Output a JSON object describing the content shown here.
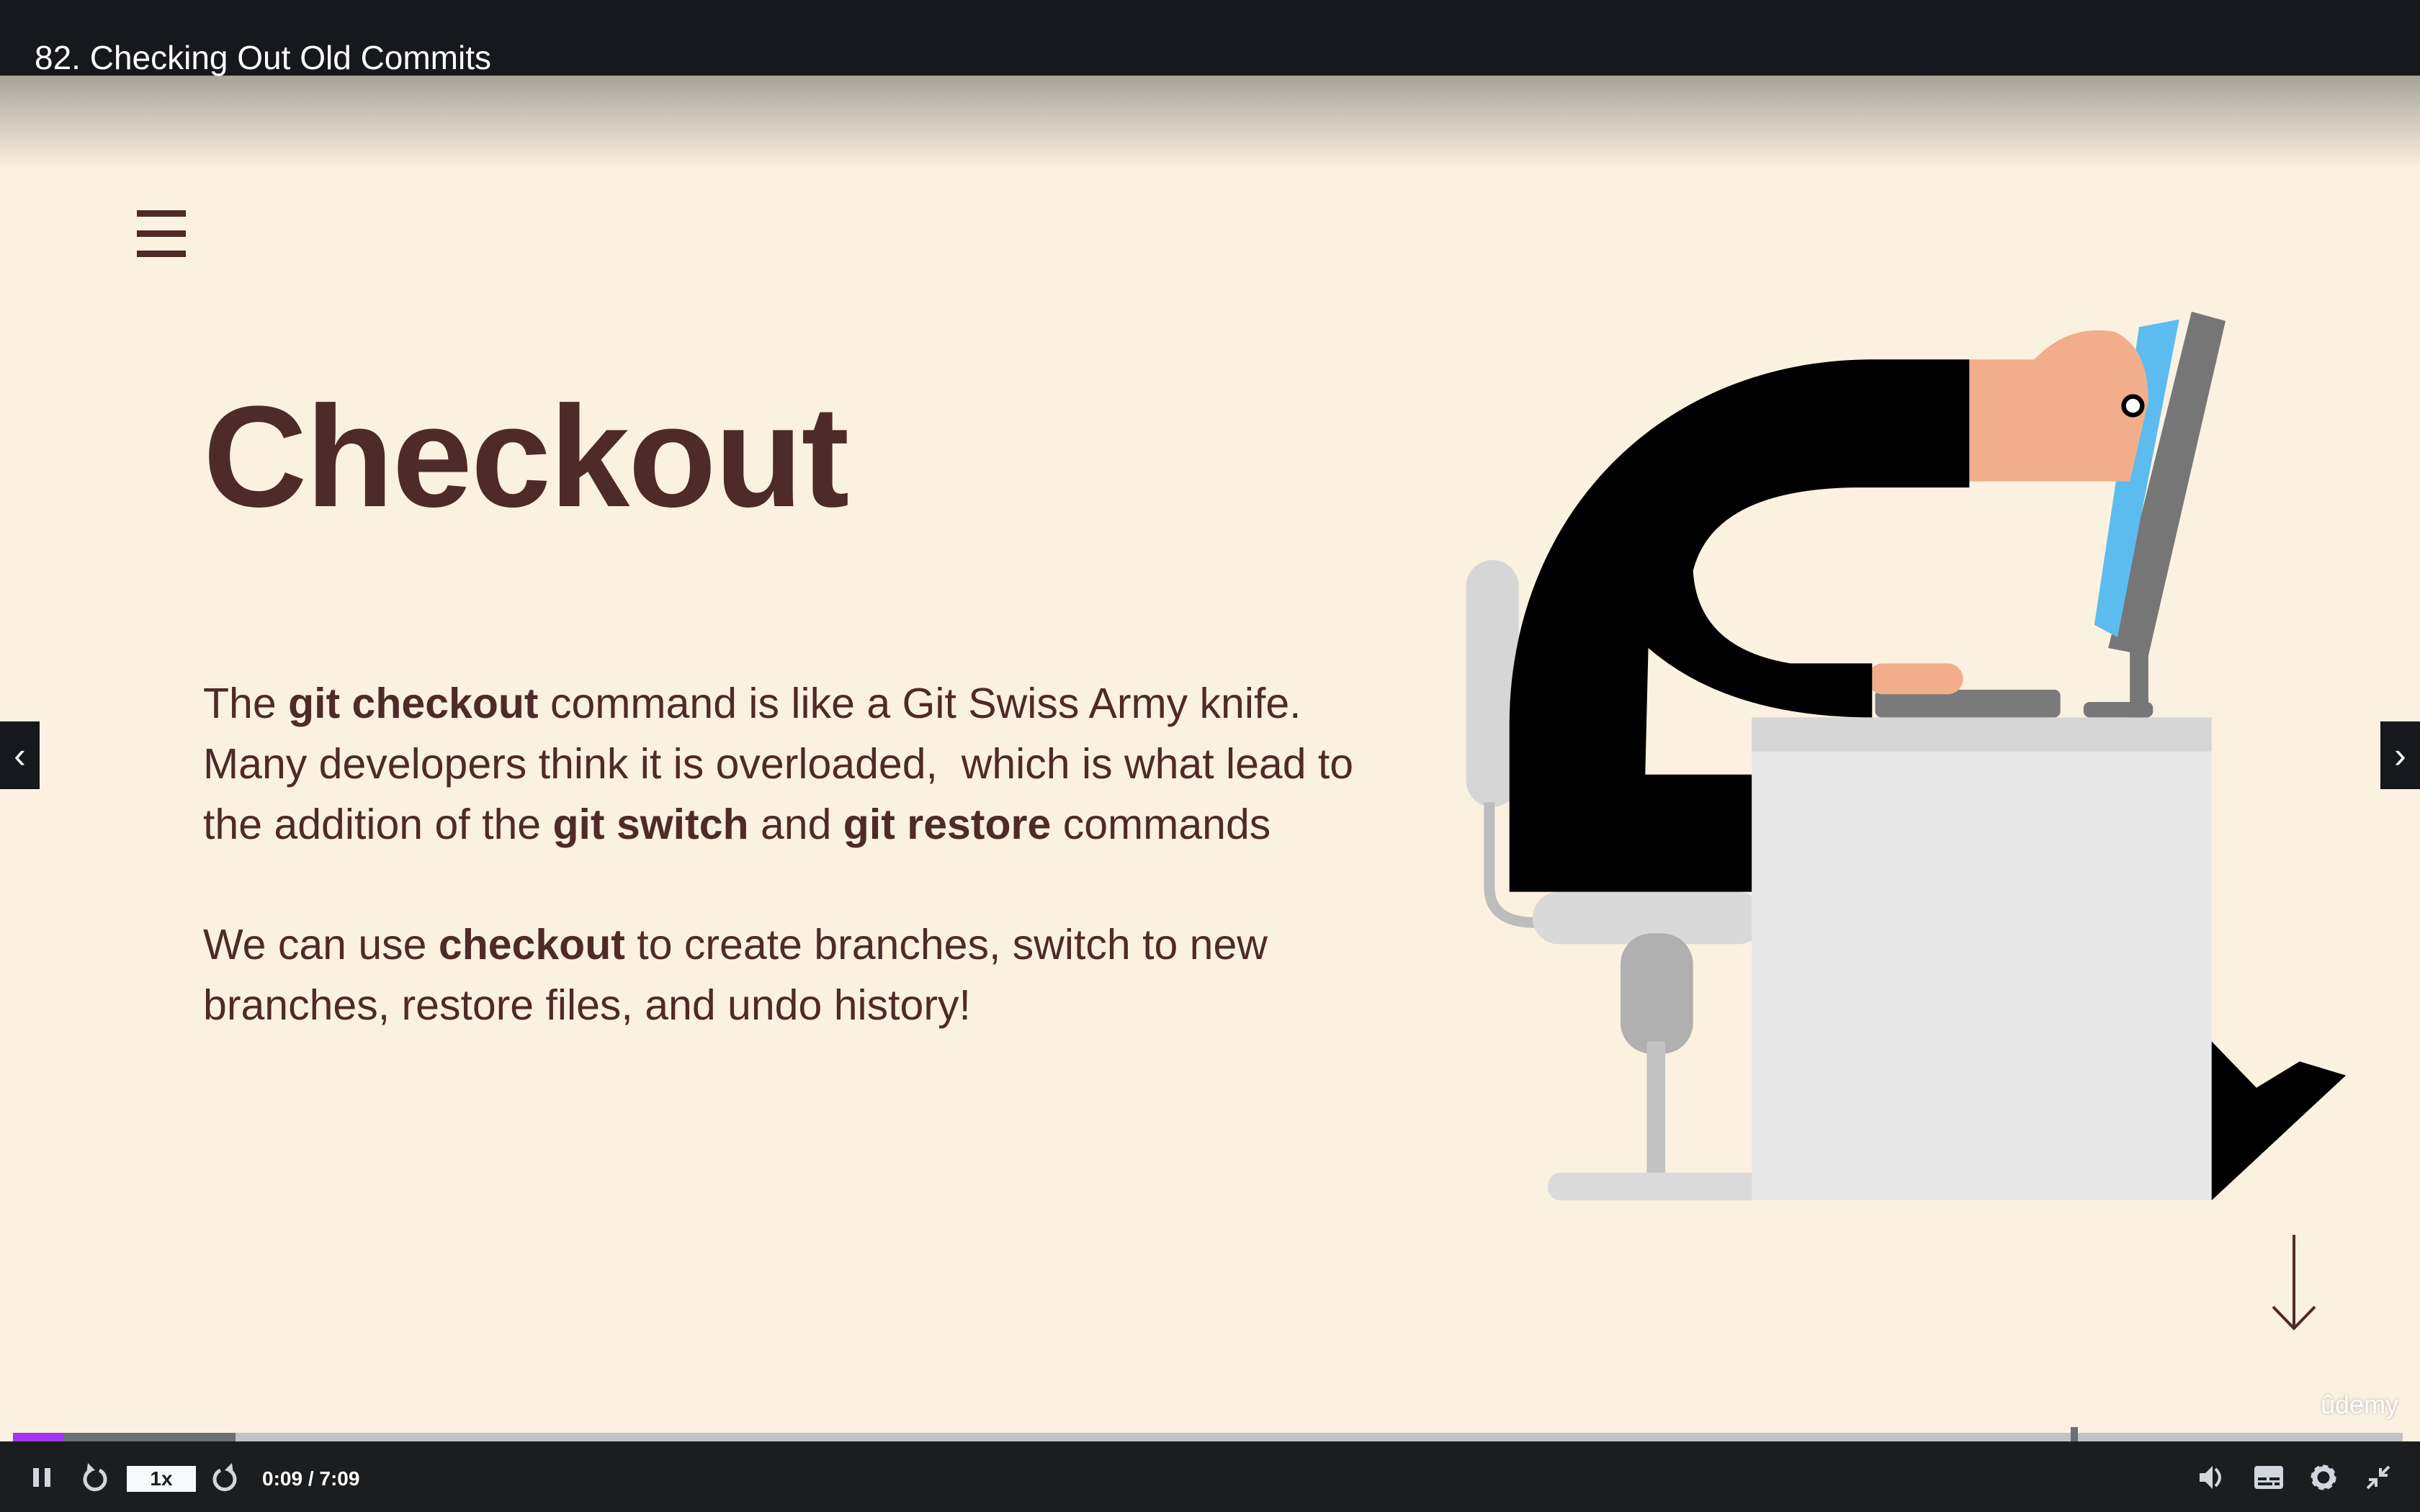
{
  "header": {
    "title": "82. Checking Out Old Commits"
  },
  "slide": {
    "heading": "Checkout",
    "paragraph1": {
      "t1": "The ",
      "b1": "git checkout",
      "t2": " command is like a Git Swiss Army knife.",
      "t3": "Many developers think it is overloaded,  which is what lead to",
      "t4": "the addition of the ",
      "b2": "git switch",
      "t5": " and ",
      "b3": "git restore",
      "t6": " commands"
    },
    "paragraph2": {
      "t1": "We can use ",
      "b1": "checkout",
      "t2": " to create branches, switch to new",
      "t3": "branches, restore files, and undo history!"
    },
    "watermark": "ûdemy"
  },
  "player": {
    "speed": "1x",
    "current_time": "0:09",
    "duration": "7:09",
    "time_display": "0:09 / 7:09",
    "progress_percent": 2.1,
    "accent_color": "#a435f0",
    "icons": [
      "pause-icon",
      "rewind-icon",
      "forward-icon",
      "volume-icon",
      "captions-icon",
      "settings-icon",
      "exit-fullscreen-icon",
      "chevron-left-icon",
      "chevron-right-icon",
      "menu-icon",
      "arrow-down-icon"
    ]
  }
}
